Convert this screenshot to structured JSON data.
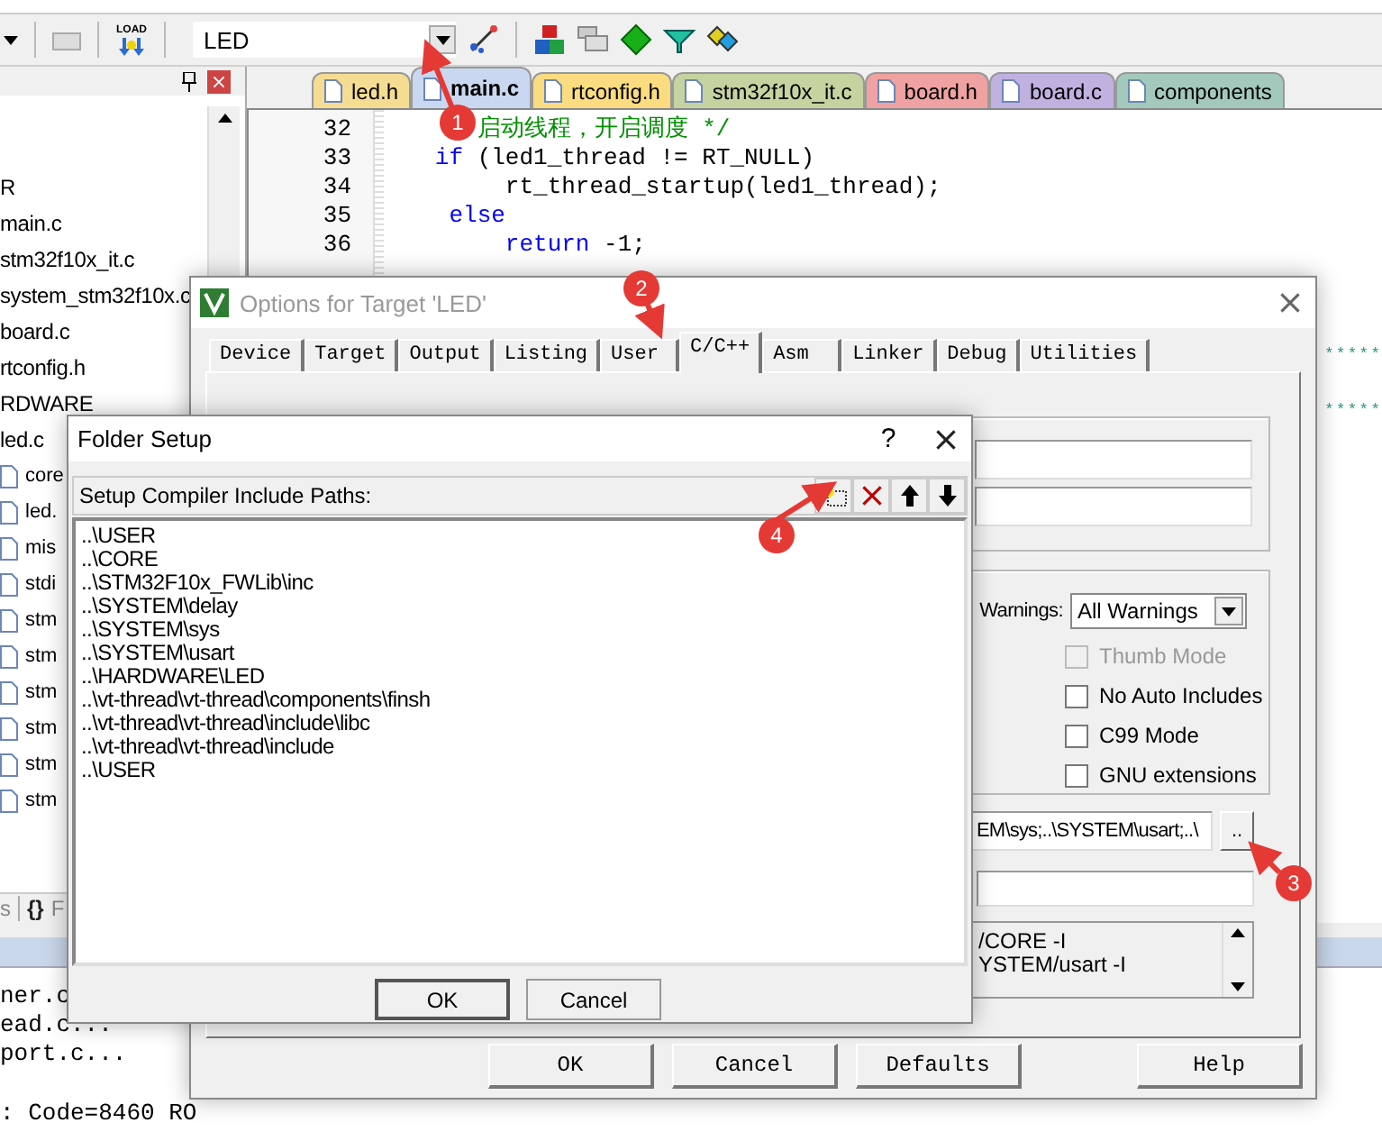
{
  "toolbar": {
    "load_label": "LOAD",
    "target": "LED"
  },
  "project_panel": {
    "items": [
      {
        "kind": "text",
        "label": "R"
      },
      {
        "kind": "text",
        "label": "main.c"
      },
      {
        "kind": "text",
        "label": "stm32f10x_it.c"
      },
      {
        "kind": "text",
        "label": "system_stm32f10x.c"
      },
      {
        "kind": "text",
        "label": "board.c"
      },
      {
        "kind": "text",
        "label": "rtconfig.h"
      },
      {
        "kind": "text",
        "label": "RDWARE"
      },
      {
        "kind": "text",
        "label": "led.c"
      },
      {
        "kind": "file",
        "label": "core"
      },
      {
        "kind": "file",
        "label": "led."
      },
      {
        "kind": "file",
        "label": "mis"
      },
      {
        "kind": "file",
        "label": "stdi"
      },
      {
        "kind": "file",
        "label": "stm"
      },
      {
        "kind": "file",
        "label": "stm"
      },
      {
        "kind": "file",
        "label": "stm"
      },
      {
        "kind": "file",
        "label": "stm"
      },
      {
        "kind": "file",
        "label": "stm"
      },
      {
        "kind": "file",
        "label": "stm"
      }
    ],
    "tabs": [
      {
        "label": "s"
      },
      {
        "glyph": "{}",
        "label": "F"
      }
    ]
  },
  "editor": {
    "tabs": [
      {
        "label": "led.h",
        "color": "#f5dc93",
        "selected": false
      },
      {
        "label": "main.c",
        "color": "#c9d8f0",
        "selected": true
      },
      {
        "label": "rtconfig.h",
        "color": "#fbdc80",
        "selected": false
      },
      {
        "label": "stm32f10x_it.c",
        "color": "#c4d3a0",
        "selected": false
      },
      {
        "label": "board.h",
        "color": "#f0a1a1",
        "selected": false
      },
      {
        "label": "board.c",
        "color": "#c0b1e1",
        "selected": false
      },
      {
        "label": "components",
        "color": "#a3c9bd",
        "selected": false
      }
    ],
    "lines": [
      {
        "number": "32",
        "tokens": [
          {
            "kind": "comment",
            "text": "      启动线程，开启调度 */"
          }
        ]
      },
      {
        "number": "33",
        "tokens": [
          {
            "kind": "keyword",
            "text": "   if"
          },
          {
            "kind": "plain",
            "text": " (led1_thread != RT_NULL)"
          }
        ]
      },
      {
        "number": "34",
        "tokens": [
          {
            "kind": "plain",
            "text": "        rt_thread_startup(led1_thread);"
          }
        ]
      },
      {
        "number": "35",
        "tokens": [
          {
            "kind": "keyword",
            "text": "    else"
          }
        ]
      },
      {
        "number": "36",
        "tokens": [
          {
            "kind": "keyword",
            "text": "        return"
          },
          {
            "kind": "plain",
            "text": " -1;"
          }
        ]
      }
    ],
    "comment_tails": [
      "*****",
      "*****"
    ]
  },
  "output": {
    "lines": [
      "ner.c",
      "ead.c...",
      "port.c..."
    ],
    "summary": ": Code=8460 RO"
  },
  "options_dialog": {
    "title": "Options for Target 'LED'",
    "tabs": [
      {
        "label": "Device",
        "selected": false
      },
      {
        "label": "Target",
        "selected": false
      },
      {
        "label": "Output",
        "selected": false
      },
      {
        "label": "Listing",
        "selected": false
      },
      {
        "label": "User",
        "selected": false
      },
      {
        "label": "C/C++",
        "selected": true
      },
      {
        "label": "Asm",
        "selected": false
      },
      {
        "label": "Linker",
        "selected": false
      },
      {
        "label": "Debug",
        "selected": false
      },
      {
        "label": "Utilities",
        "selected": false
      }
    ],
    "warnings": {
      "label": "Warnings:",
      "value": "All Warnings"
    },
    "checkboxes": [
      {
        "label": "Thumb Mode",
        "checked": false,
        "disabled": true
      },
      {
        "label": "No Auto Includes",
        "checked": false,
        "disabled": false
      },
      {
        "label": "C99 Mode",
        "checked": false,
        "disabled": false
      },
      {
        "label": "GNU extensions",
        "checked": false,
        "disabled": false
      }
    ],
    "include_paths": {
      "value": "EM\\sys;..\\SYSTEM\\usart;..\\",
      "button": ".."
    },
    "compiler_control": [
      "/CORE -I",
      "YSTEM/usart -I"
    ],
    "buttons": [
      "OK",
      "Cancel",
      "Defaults",
      "Help"
    ]
  },
  "folder_dialog": {
    "title": "Folder Setup",
    "help": "?",
    "header": "Setup Compiler Include Paths:",
    "paths": [
      "..\\USER",
      "..\\CORE",
      "..\\STM32F10x_FWLib\\inc",
      "..\\SYSTEM\\delay",
      "..\\SYSTEM\\sys",
      "..\\SYSTEM\\usart",
      "..\\HARDWARE\\LED",
      "..\\vt-thread\\vt-thread\\components\\finsh",
      "..\\vt-thread\\vt-thread\\include\\libc",
      "..\\vt-thread\\vt-thread\\include",
      "..\\USER"
    ],
    "buttons": [
      {
        "label": "OK",
        "default": true
      },
      {
        "label": "Cancel",
        "default": false
      }
    ]
  },
  "annotations": [
    {
      "number": "1"
    },
    {
      "number": "2"
    },
    {
      "number": "3"
    },
    {
      "number": "4"
    }
  ]
}
